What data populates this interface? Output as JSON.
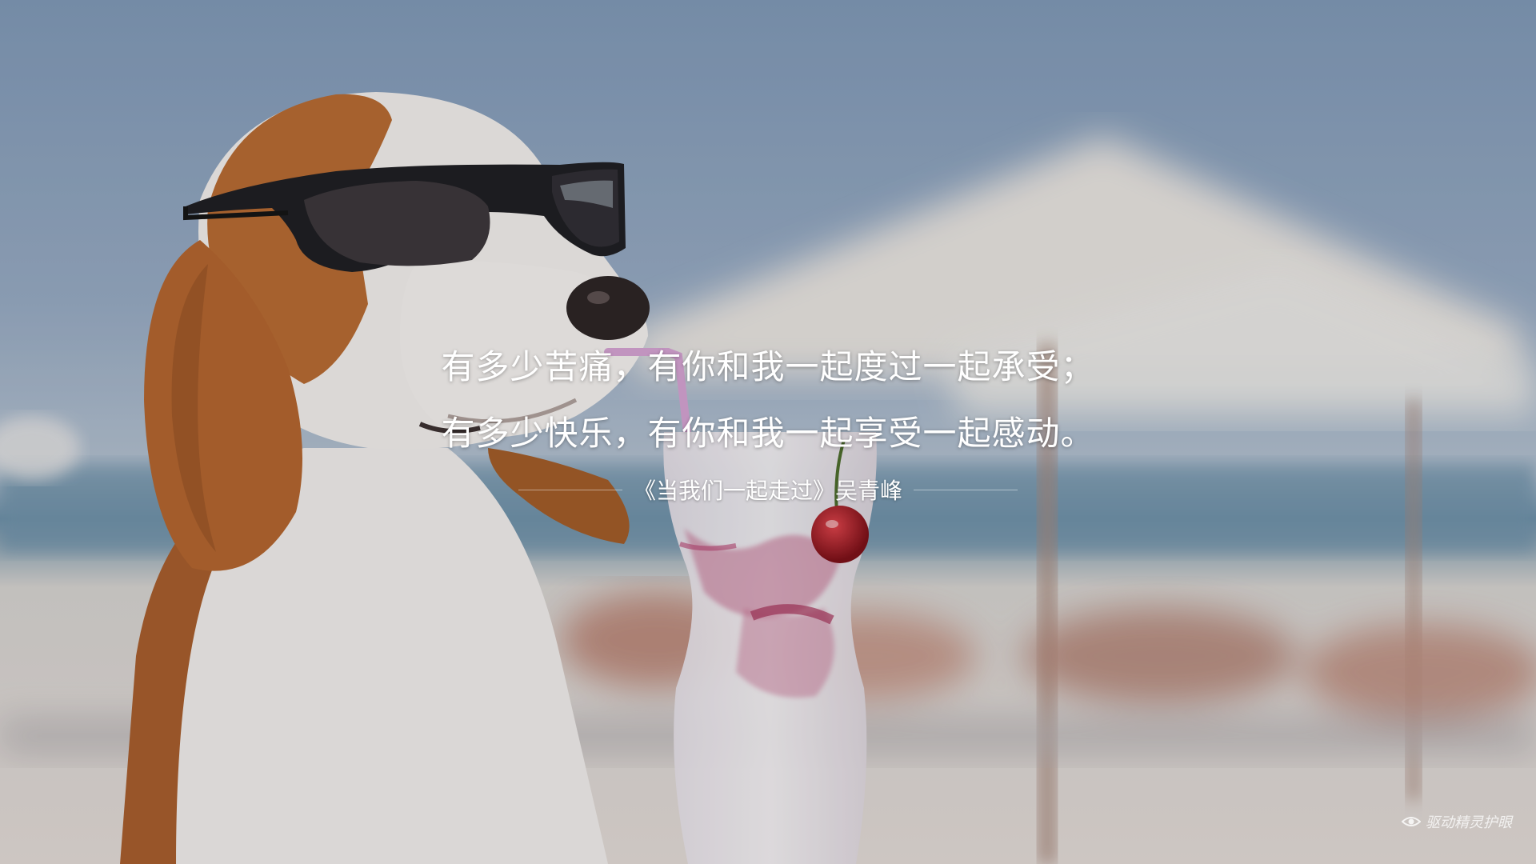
{
  "quote": {
    "line1": "有多少苦痛，有你和我一起度过一起承受；",
    "line2": "有多少快乐，有你和我一起享受一起感动。",
    "source": "《当我们一起走过》吴青峰"
  },
  "watermark": {
    "icon": "eye-icon",
    "label": "驱动精灵护眼"
  },
  "colors": {
    "sky": "#8da4be",
    "dog_tan": "#b86a35",
    "cherry": "#a3141e",
    "text": "#ffffff"
  }
}
